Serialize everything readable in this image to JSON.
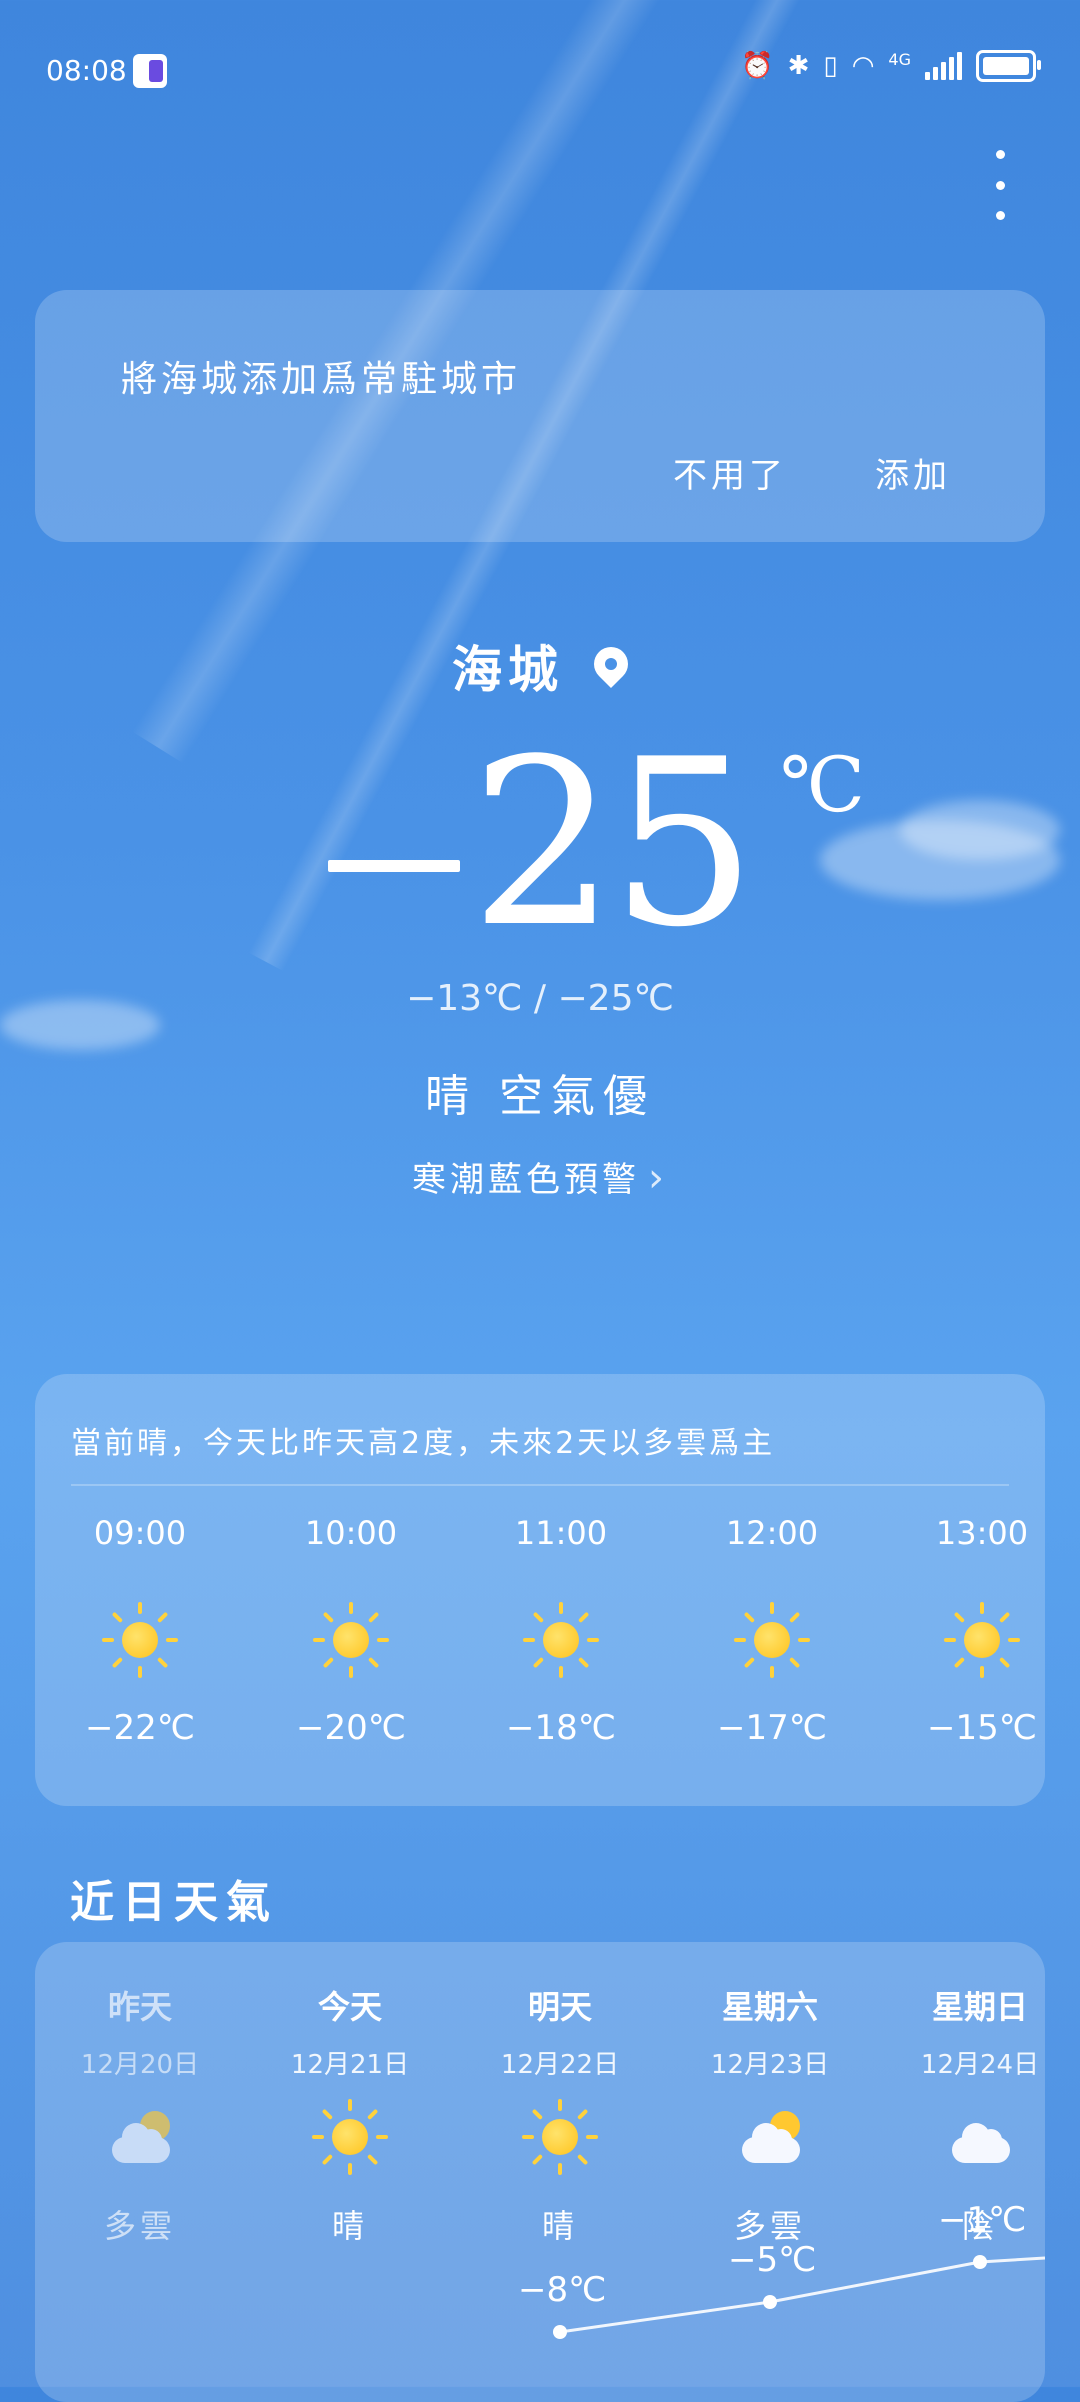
{
  "status_bar": {
    "time": "08:08",
    "network": "4G"
  },
  "banner": {
    "text": "將海城添加爲常駐城市",
    "dismiss": "不用了",
    "add": "添加"
  },
  "current": {
    "city": "海城",
    "temp": "25",
    "unit": "℃",
    "range": "−13℃  /  −25℃",
    "condition": "晴  空氣優",
    "warning": "寒潮藍色預警"
  },
  "hourly": {
    "summary": "當前晴，今天比昨天高2度，未來2天以多雲爲主",
    "items": [
      {
        "time": "09:00",
        "icon": "sun-icon",
        "temp": "−22℃"
      },
      {
        "time": "10:00",
        "icon": "sun-icon",
        "temp": "−20℃"
      },
      {
        "time": "11:00",
        "icon": "sun-icon",
        "temp": "−18℃"
      },
      {
        "time": "12:00",
        "icon": "sun-icon",
        "temp": "−17℃"
      },
      {
        "time": "13:00",
        "icon": "sun-icon",
        "temp": "−15℃"
      }
    ]
  },
  "daily": {
    "title": "近日天氣",
    "items": [
      {
        "name": "昨天",
        "date": "12月20日",
        "icon": "partly-cloudy-icon",
        "cond": "多雲",
        "high": ""
      },
      {
        "name": "今天",
        "date": "12月21日",
        "icon": "sun-icon",
        "cond": "晴",
        "high": ""
      },
      {
        "name": "明天",
        "date": "12月22日",
        "icon": "sun-icon",
        "cond": "晴",
        "high": "−8℃"
      },
      {
        "name": "星期六",
        "date": "12月23日",
        "icon": "partly-cloudy-icon",
        "cond": "多雲",
        "high": "−5℃"
      },
      {
        "name": "星期日",
        "date": "12月24日",
        "icon": "cloud-icon",
        "cond": "陰",
        "high": "−1℃"
      }
    ]
  },
  "colors": {
    "sun": "#ffc21b",
    "background": "#4a92e6"
  }
}
